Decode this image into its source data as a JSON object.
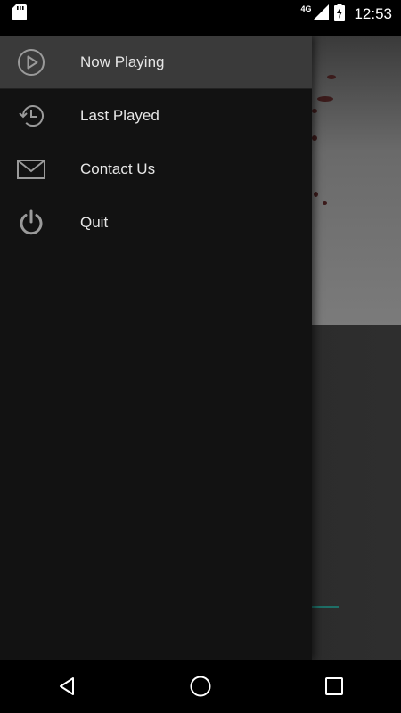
{
  "status_bar": {
    "time": "12:53",
    "network_type": "4G",
    "icons": [
      "sd-card-icon",
      "signal-icon",
      "battery-charging-icon"
    ]
  },
  "drawer": {
    "items": [
      {
        "label": "Now Playing",
        "icon": "play-circle-icon",
        "active": true
      },
      {
        "label": "Last Played",
        "icon": "history-icon",
        "active": false
      },
      {
        "label": "Contact Us",
        "icon": "envelope-icon",
        "active": false
      },
      {
        "label": "Quit",
        "icon": "power-icon",
        "active": false
      }
    ]
  },
  "nav_bar": {
    "icons": [
      "back-icon",
      "home-icon",
      "recents-icon"
    ]
  },
  "colors": {
    "drawer_bg": "#121212",
    "active_item_bg": "#3a3a3a",
    "accent": "#1e6f67"
  }
}
